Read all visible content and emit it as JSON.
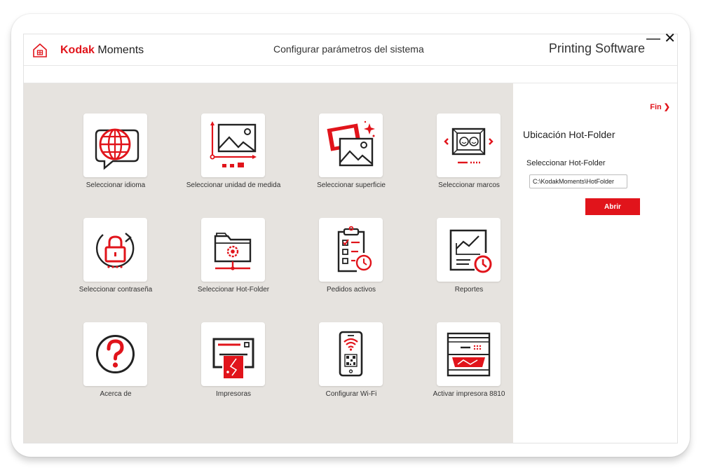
{
  "header": {
    "brand_kodak": "Kodak",
    "brand_moments": "Moments",
    "page_title": "Configurar parámetros del sistema",
    "product_title": "Printing Software",
    "minimize_label": "—",
    "close_label": "✕"
  },
  "tiles": [
    {
      "label": "Seleccionar idioma",
      "icon": "globe-chat-icon"
    },
    {
      "label": "Seleccionar unidad de medida",
      "icon": "image-measure-icon"
    },
    {
      "label": "Seleccionar superficie",
      "icon": "photos-surface-icon"
    },
    {
      "label": "Seleccionar marcos",
      "icon": "frame-icon"
    },
    {
      "label": "Seleccionar contraseña",
      "icon": "padlock-icon"
    },
    {
      "label": "Seleccionar Hot-Folder",
      "icon": "network-folder-icon"
    },
    {
      "label": "Pedidos activos",
      "icon": "clipboard-checklist-icon"
    },
    {
      "label": "Reportes",
      "icon": "report-chart-icon"
    },
    {
      "label": "Acerca de",
      "icon": "question-icon"
    },
    {
      "label": "Impresoras",
      "icon": "printer-icon"
    },
    {
      "label": "Configurar Wi-Fi",
      "icon": "phone-wifi-icon"
    },
    {
      "label": "Activar impresora 8810",
      "icon": "printer-8810-icon"
    }
  ],
  "side": {
    "fin_label": "Fin ❯",
    "title": "Ubicación Hot-Folder",
    "field_label": "Seleccionar Hot-Folder",
    "path_value": "C:\\KodakMoments\\HotFolder",
    "open_button": "Abrir"
  },
  "colors": {
    "accent": "#e1141b",
    "panel_bg": "#e6e3df"
  }
}
